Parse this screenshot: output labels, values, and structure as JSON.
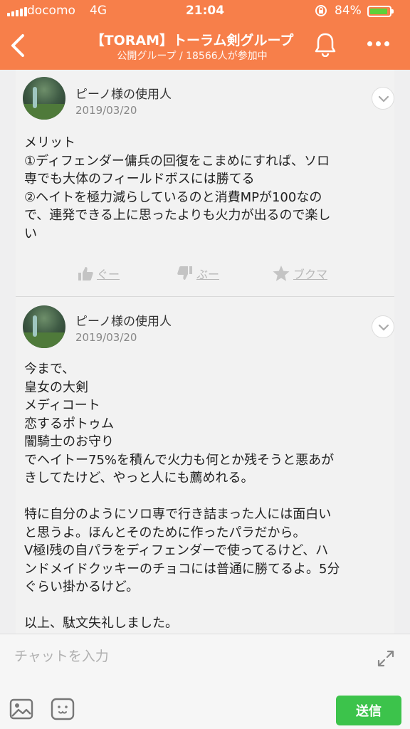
{
  "status": {
    "carrier": "docomo",
    "network": "4G",
    "time": "21:04",
    "battery": "84%",
    "battery_level": 0.84
  },
  "header": {
    "title": "【TORAM】トーラム剣グループ",
    "subtitle": "公開グループ / 18566人が参加中"
  },
  "posts": [
    {
      "author": "ピーノ様の使用人",
      "date": "2019/03/20",
      "lines": [
        "メリット",
        "①ディフェンダー傭兵の回復をこまめにすれば、ソロ",
        "専でも大体のフィールドボスには勝てる",
        "②ヘイトを極力減らしているのと消費MPが100なの",
        "で、連発できる上に思ったよりも火力が出るので楽し",
        "い"
      ],
      "actions": {
        "good": "ぐー",
        "boo": "ぶー",
        "bookmark": "ブクマ"
      }
    },
    {
      "author": "ピーノ様の使用人",
      "date": "2019/03/20",
      "lines": [
        "今まで、",
        "皇女の大剣",
        "メディコート",
        "恋するポトゥム",
        "闇騎士のお守り",
        "でヘイトー75%を積んで火力も何とか残そうと悪あが",
        "きしてたけど、やっと人にも薦めれる。",
        "",
        "特に自分のようにソロ専で行き詰まった人には面白い",
        "と思うよ。ほんとそのために作ったパラだから。",
        "V極l残の自パラをディフェンダーで使ってるけど、ハ",
        "ンドメイドクッキーのチョコには普通に勝てるよ。5分",
        "ぐらい掛かるけど。",
        "",
        "以上、駄文失礼しました。"
      ]
    }
  ],
  "input": {
    "placeholder": "チャットを入力",
    "send_label": "送信"
  },
  "colors": {
    "header": "#f77f4a",
    "send": "#3cc34b",
    "battery": "#5dd13a"
  }
}
